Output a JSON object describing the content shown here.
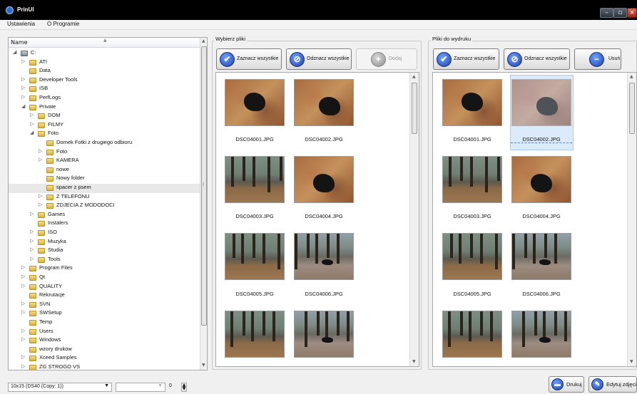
{
  "window": {
    "title": "PrinUI",
    "min": "–",
    "max": "▫",
    "close": "×"
  },
  "menu": [
    "Ustawienia",
    "O Programie"
  ],
  "tree": {
    "header": "Name",
    "items": [
      {
        "label": "C:",
        "level": 0,
        "arrow": "◢",
        "drive": true
      },
      {
        "label": "ATI",
        "level": 1,
        "arrow": "▷"
      },
      {
        "label": "Data",
        "level": 1,
        "arrow": ""
      },
      {
        "label": "Developer Tools",
        "level": 1,
        "arrow": "▷"
      },
      {
        "label": "ISB",
        "level": 1,
        "arrow": "▷"
      },
      {
        "label": "PerfLogs",
        "level": 1,
        "arrow": "▷"
      },
      {
        "label": "Private",
        "level": 1,
        "arrow": "◢"
      },
      {
        "label": "DOM",
        "level": 2,
        "arrow": "▷"
      },
      {
        "label": "FILMY",
        "level": 2,
        "arrow": "▷"
      },
      {
        "label": "Foto",
        "level": 2,
        "arrow": "◢"
      },
      {
        "label": "Domek Fotki z drugiego odbioru",
        "level": 3,
        "arrow": ""
      },
      {
        "label": "Foto",
        "level": 3,
        "arrow": "▷"
      },
      {
        "label": "KAMERA",
        "level": 3,
        "arrow": "▷"
      },
      {
        "label": "nowe",
        "level": 3,
        "arrow": ""
      },
      {
        "label": "Nowy folder",
        "level": 3,
        "arrow": ""
      },
      {
        "label": "spacer z psem",
        "level": 3,
        "arrow": "",
        "selected": true
      },
      {
        "label": "Z TELEFONU",
        "level": 3,
        "arrow": "▷"
      },
      {
        "label": "ZDJECIA Z MODODOCI",
        "level": 3,
        "arrow": "▷"
      },
      {
        "label": "Games",
        "level": 2,
        "arrow": "▷"
      },
      {
        "label": "Instalers",
        "level": 2,
        "arrow": ""
      },
      {
        "label": "ISO",
        "level": 2,
        "arrow": "▷"
      },
      {
        "label": "Muzyka",
        "level": 2,
        "arrow": "▷"
      },
      {
        "label": "Studia",
        "level": 2,
        "arrow": "▷"
      },
      {
        "label": "Tools",
        "level": 2,
        "arrow": "▷"
      },
      {
        "label": "Program Files",
        "level": 1,
        "arrow": "▷"
      },
      {
        "label": "Qt",
        "level": 1,
        "arrow": "▷"
      },
      {
        "label": "QUALITY",
        "level": 1,
        "arrow": "▷"
      },
      {
        "label": "Rekrutacje",
        "level": 1,
        "arrow": ""
      },
      {
        "label": "SVN",
        "level": 1,
        "arrow": "▷"
      },
      {
        "label": "SWSetup",
        "level": 1,
        "arrow": "▷"
      },
      {
        "label": "Temp",
        "level": 1,
        "arrow": ""
      },
      {
        "label": "Users",
        "level": 1,
        "arrow": "▷"
      },
      {
        "label": "Windows",
        "level": 1,
        "arrow": "▷"
      },
      {
        "label": "wzory drukow",
        "level": 1,
        "arrow": ""
      },
      {
        "label": "Xceed Samples",
        "level": 1,
        "arrow": "▷"
      },
      {
        "label": "ZG STROGO VS",
        "level": 1,
        "arrow": "▷"
      }
    ]
  },
  "left_panel": {
    "group_label": "Wybierz pliki",
    "select_all": "Zaznacz wszystkie",
    "deselect_all": "Odznacz wszystkie",
    "add": "Dodaj",
    "files": [
      {
        "name": "DSC04001.JPG",
        "scene": "leaves"
      },
      {
        "name": "DSC04002.JPG",
        "scene": "leaves"
      },
      {
        "name": "DSC04003.JPG",
        "scene": "park"
      },
      {
        "name": "DSC04004.JPG",
        "scene": "leaves"
      },
      {
        "name": "DSC04005.JPG",
        "scene": "park"
      },
      {
        "name": "DSC04006.JPG",
        "scene": "path"
      },
      {
        "name": "",
        "scene": "park"
      },
      {
        "name": "",
        "scene": "path"
      }
    ]
  },
  "right_panel": {
    "group_label": "Pliki do wydruku",
    "select_all": "Zaznacz wszystkie",
    "deselect_all": "Odznacz wszystkie",
    "remove": "Usuń",
    "selected_file": "DSC04002.JPG",
    "files": [
      {
        "name": "DSC04001.JPG",
        "scene": "leaves"
      },
      {
        "name": "DSC04002.JPG",
        "scene": "leaves"
      },
      {
        "name": "DSC04003.JPG",
        "scene": "park"
      },
      {
        "name": "DSC04004.JPG",
        "scene": "leaves"
      },
      {
        "name": "DSC04005.JPG",
        "scene": "park"
      },
      {
        "name": "DSC04006.JPG",
        "scene": "path"
      },
      {
        "name": "",
        "scene": "park"
      },
      {
        "name": "",
        "scene": "path"
      }
    ]
  },
  "statusbar": {
    "format": "10x15 (DS40 (Copy: 1))",
    "second_combo": "",
    "copies": "0",
    "print": "Drukuj",
    "edit": "Edytuj zdjęcia"
  },
  "icons": {
    "check": "✔",
    "cancel": "⊘",
    "plus": "+",
    "minus": "−"
  }
}
